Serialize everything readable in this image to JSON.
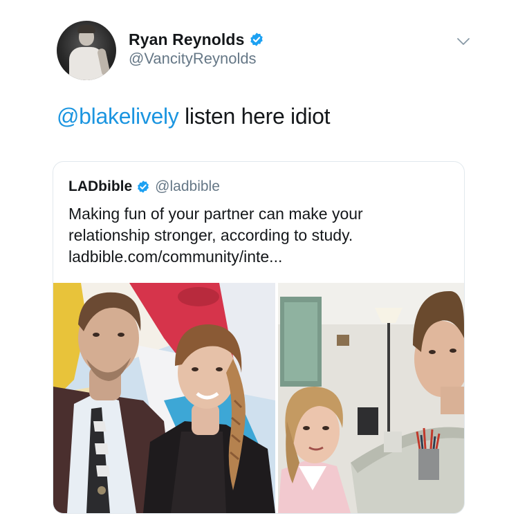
{
  "tweet": {
    "author": {
      "display_name": "Ryan Reynolds",
      "handle": "@VancityReynolds",
      "verified": true
    },
    "text": {
      "mention": "@blakelively",
      "body": " listen here idiot"
    },
    "quoted_tweet": {
      "author": {
        "display_name": "LADbible",
        "handle": "@ladbible",
        "verified": true
      },
      "text_lines": [
        "Making fun of your partner can make your",
        "relationship stronger, according to study.",
        "ladbible.com/community/inte..."
      ],
      "media": {
        "left_image": "couple-photo",
        "right_image": "office-photo"
      }
    }
  },
  "icons": {
    "verified": "verified-badge-icon",
    "menu": "chevron-down-icon"
  },
  "colors": {
    "text_primary": "#14171a",
    "text_secondary": "#657786",
    "link": "#1b95e0",
    "verified": "#1da1f2",
    "card_border": "#e1e8ed"
  }
}
